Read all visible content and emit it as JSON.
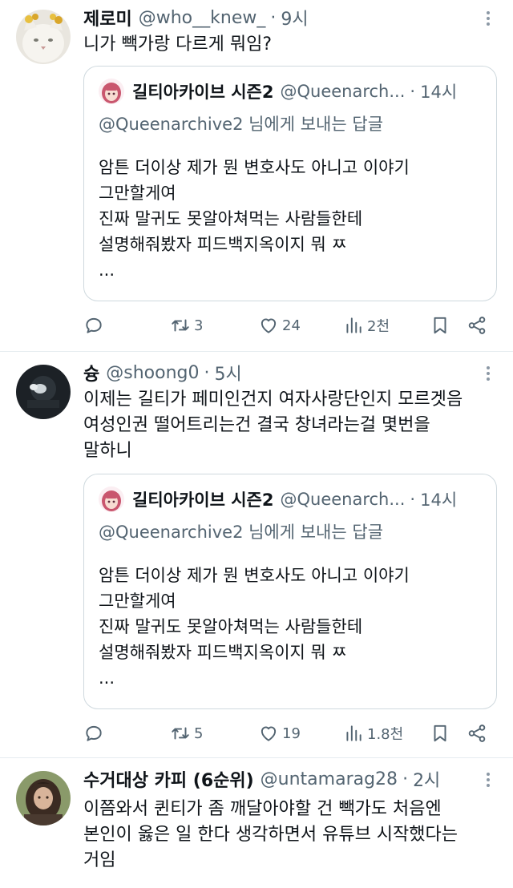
{
  "tweets": [
    {
      "name": "제로미",
      "handle": "@who__knew_",
      "time": "9시",
      "lines": [
        "니가 빽가랑 다르게 뭐임?"
      ],
      "quote": {
        "name": "길티아카이브 시즌2",
        "handle": "@Queenarch...",
        "time": "14시",
        "reply": "@Queenarchive2 님에게 보내는 답글",
        "lines": [
          "암튼 더이상 제가 뭔 변호사도 아니고 이야기",
          "그만할게여",
          "진짜 말귀도 못알아쳐먹는 사람들한테",
          "설명해줘봤자 피드백지옥이지 뭐 ㅉ",
          "..."
        ]
      },
      "reposts": "3",
      "likes": "24",
      "views": "2천"
    },
    {
      "name": "슝",
      "handle": "@shoong0",
      "time": "5시",
      "lines": [
        "이제는 길티가 페미인건지 여자사랑단인지 모르겟음",
        "여성인권 떨어트리는건 결국 창녀라는걸 몇번을",
        "말하니"
      ],
      "quote": {
        "name": "길티아카이브 시즌2",
        "handle": "@Queenarch...",
        "time": "14시",
        "reply": "@Queenarchive2 님에게 보내는 답글",
        "lines": [
          "암튼 더이상 제가 뭔 변호사도 아니고 이야기",
          "그만할게여",
          "진짜 말귀도 못알아쳐먹는 사람들한테",
          "설명해줘봤자 피드백지옥이지 뭐 ㅉ",
          "..."
        ]
      },
      "reposts": "5",
      "likes": "19",
      "views": "1.8천"
    },
    {
      "name": "수거대상 카피 (6순위)",
      "handle": "@untamarag28",
      "time": "2시",
      "lines": [
        "이쯤와서 퀸티가 좀 깨달아야할 건 빽가도 처음엔",
        "본인이 옳은 일 한다 생각하면서 유튜브 시작했다는",
        "거임"
      ]
    }
  ],
  "icons": [
    "reply-icon",
    "repost-icon",
    "like-icon",
    "views-icon",
    "bookmark-icon",
    "share-icon",
    "more-icon"
  ],
  "colors": {
    "secondary_text": "#536471",
    "border": "#cfd9de",
    "primary_text": "#0f1419"
  }
}
